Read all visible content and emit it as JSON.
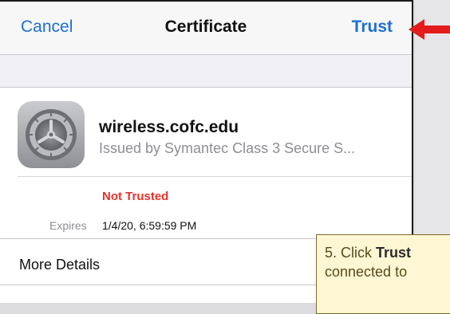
{
  "navbar": {
    "cancel_label": "Cancel",
    "title": "Certificate",
    "trust_label": "Trust"
  },
  "certificate": {
    "icon": "settings-gear-icon",
    "site_name": "wireless.cofc.edu",
    "issuer": "Issued by Symantec Class 3 Secure S...",
    "status": "Not Trusted",
    "expires_label": "Expires",
    "expires_value": "1/4/20, 6:59:59 PM",
    "more_details_label": "More Details"
  },
  "callout": {
    "prefix": "5. Click ",
    "emphasis": "Trust",
    "line2": "connected to"
  },
  "colors": {
    "link_blue": "#1f6fd1",
    "not_trusted_red": "#e8322d",
    "arrow_red": "#e41b1b",
    "callout_bg": "#fff6d4"
  }
}
